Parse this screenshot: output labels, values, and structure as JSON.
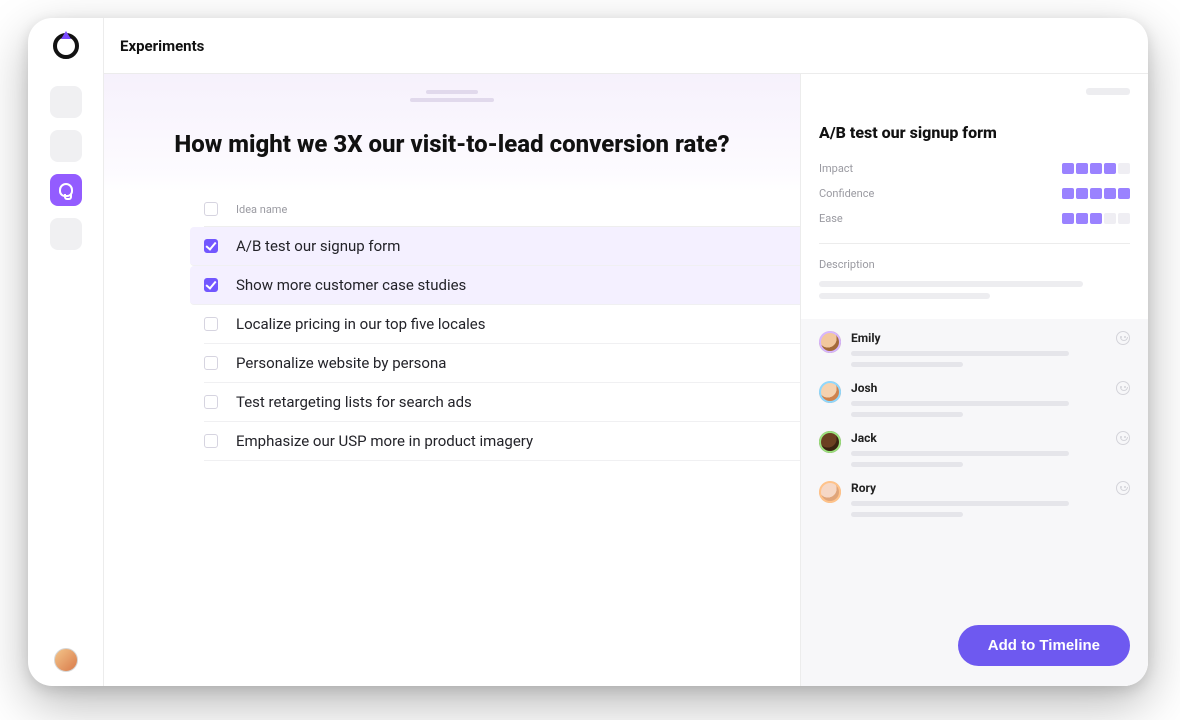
{
  "header": {
    "title": "Experiments"
  },
  "sidebar": {
    "active_icon": "lightbulb-icon"
  },
  "hero": {
    "heading": "How might we 3X our visit-to-lead conversion rate?"
  },
  "ideas": {
    "column_label": "Idea name",
    "rows": [
      {
        "label": "A/B test our signup form",
        "checked": true
      },
      {
        "label": "Show more customer case studies",
        "checked": true
      },
      {
        "label": "Localize pricing in our top five locales",
        "checked": false
      },
      {
        "label": "Personalize website by persona",
        "checked": false
      },
      {
        "label": "Test retargeting lists for search ads",
        "checked": false
      },
      {
        "label": "Emphasize our USP more in product imagery",
        "checked": false
      }
    ]
  },
  "panel": {
    "title": "A/B test our signup form",
    "metrics": [
      {
        "label": "Impact",
        "value": 4,
        "max": 5
      },
      {
        "label": "Confidence",
        "value": 5,
        "max": 5
      },
      {
        "label": "Ease",
        "value": 3,
        "max": 5
      }
    ],
    "description_label": "Description",
    "comments": [
      {
        "name": "Emily",
        "avatar": "av-emily"
      },
      {
        "name": "Josh",
        "avatar": "av-josh"
      },
      {
        "name": "Jack",
        "avatar": "av-jack"
      },
      {
        "name": "Rory",
        "avatar": "av-rory"
      }
    ],
    "cta_label": "Add to Timeline"
  }
}
